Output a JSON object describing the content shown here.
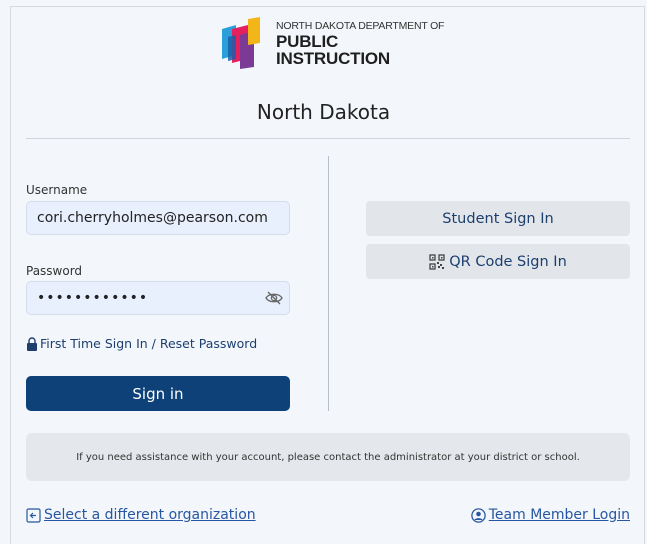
{
  "logo": {
    "line1": "NORTH DAKOTA DEPARTMENT OF",
    "line2": "PUBLIC INSTRUCTION",
    "colors": [
      "#f2b619",
      "#e4205f",
      "#7a3a96",
      "#2b9fd9",
      "#1b5fa8"
    ]
  },
  "organization_title": "North Dakota",
  "login_form": {
    "username_label": "Username",
    "username_value": "cori.cherryholmes@pearson.com",
    "password_label": "Password",
    "password_value": "••••••••••••",
    "toggle_visibility_icon": "eye-slash-icon",
    "reset_link_icon": "lock-icon",
    "reset_link_label": "First Time Sign In / Reset Password",
    "signin_label": "Sign in"
  },
  "alternate_signin": {
    "student_label": "Student Sign In",
    "qr_icon": "qr-code-icon",
    "qr_label": "QR Code Sign In"
  },
  "assistance_notice": "If you need assistance with your account, please contact the administrator at your district or school.",
  "footer": {
    "select_org_icon": "arrow-left-box-icon",
    "select_org_label": "Select a different organization",
    "team_member_icon": "user-circle-icon",
    "team_member_label": "Team Member Login"
  },
  "colors": {
    "primary_button": "#0e4178",
    "link": "#2757a3",
    "input_background": "#e8f0fe",
    "secondary_button": "#e2e6eb"
  }
}
